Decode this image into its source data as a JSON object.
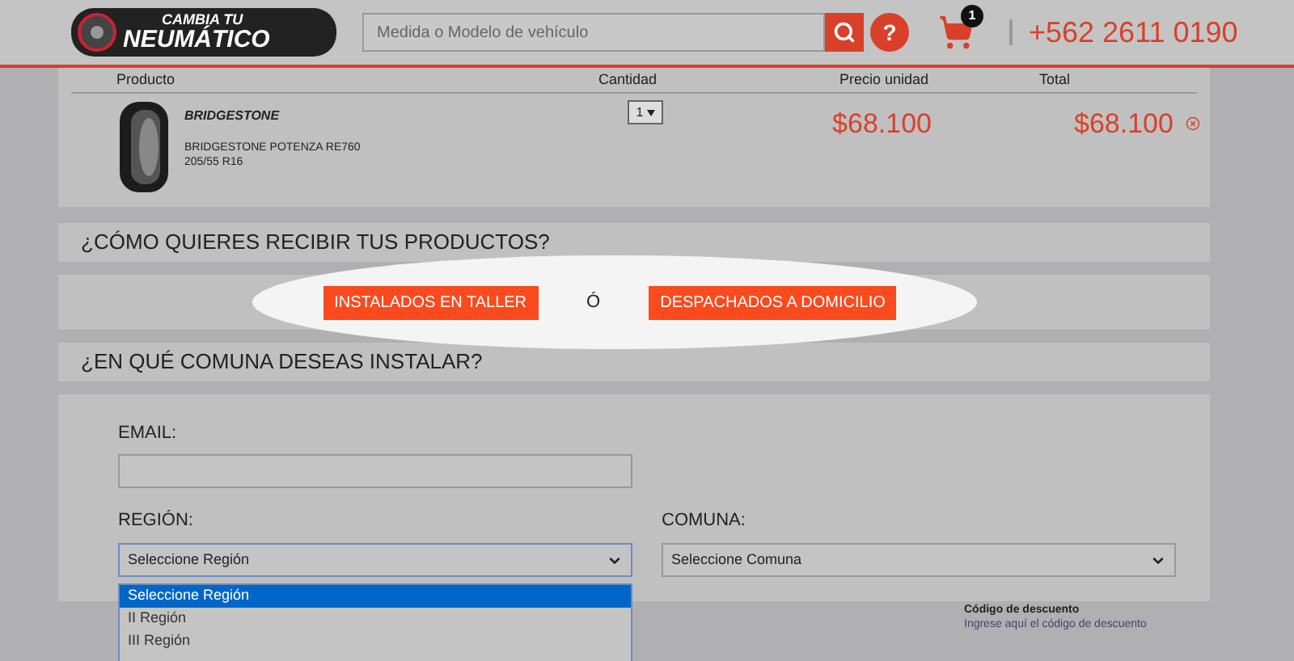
{
  "header": {
    "logo_top": "CAMBIA TU",
    "logo_bottom": "NEUMÁTICO",
    "search": {
      "placeholder": "Medida o Modelo de vehículo"
    },
    "help": "?",
    "cart_count": "1",
    "phone": "+562 2611 0190"
  },
  "cart": {
    "columns": [
      "Producto",
      "Cantidad",
      "Precio unidad",
      "Total"
    ],
    "items": [
      {
        "brand": "BRIDGESTONE",
        "name": "BRIDGESTONE POTENZA RE760",
        "size": "205/55 R16",
        "quantity": "1",
        "unit_price": "$68.100",
        "total": "$68.100"
      }
    ]
  },
  "delivery": {
    "title": "¿CÓMO QUIERES RECIBIR TUS PRODUCTOS?",
    "option_a": "INSTALADOS EN TALLER",
    "separator": "Ó",
    "option_b": "DESPACHADOS A DOMICILIO"
  },
  "install": {
    "title": "¿EN QUÉ COMUNA DESEAS INSTALAR?",
    "email_label": "EMAIL:",
    "region_label": "REGIÓN:",
    "region_value": "Seleccione Región",
    "comuna_label": "COMUNA:",
    "comuna_value": "Seleccione Comuna",
    "region_options": [
      {
        "label": "Seleccione Región",
        "selected": true
      },
      {
        "label": "II Región",
        "selected": false
      },
      {
        "label": "III Región",
        "selected": false
      }
    ]
  },
  "discount": {
    "title": "Código de descuento",
    "hint": "Ingrese aquí el código de descuento"
  }
}
